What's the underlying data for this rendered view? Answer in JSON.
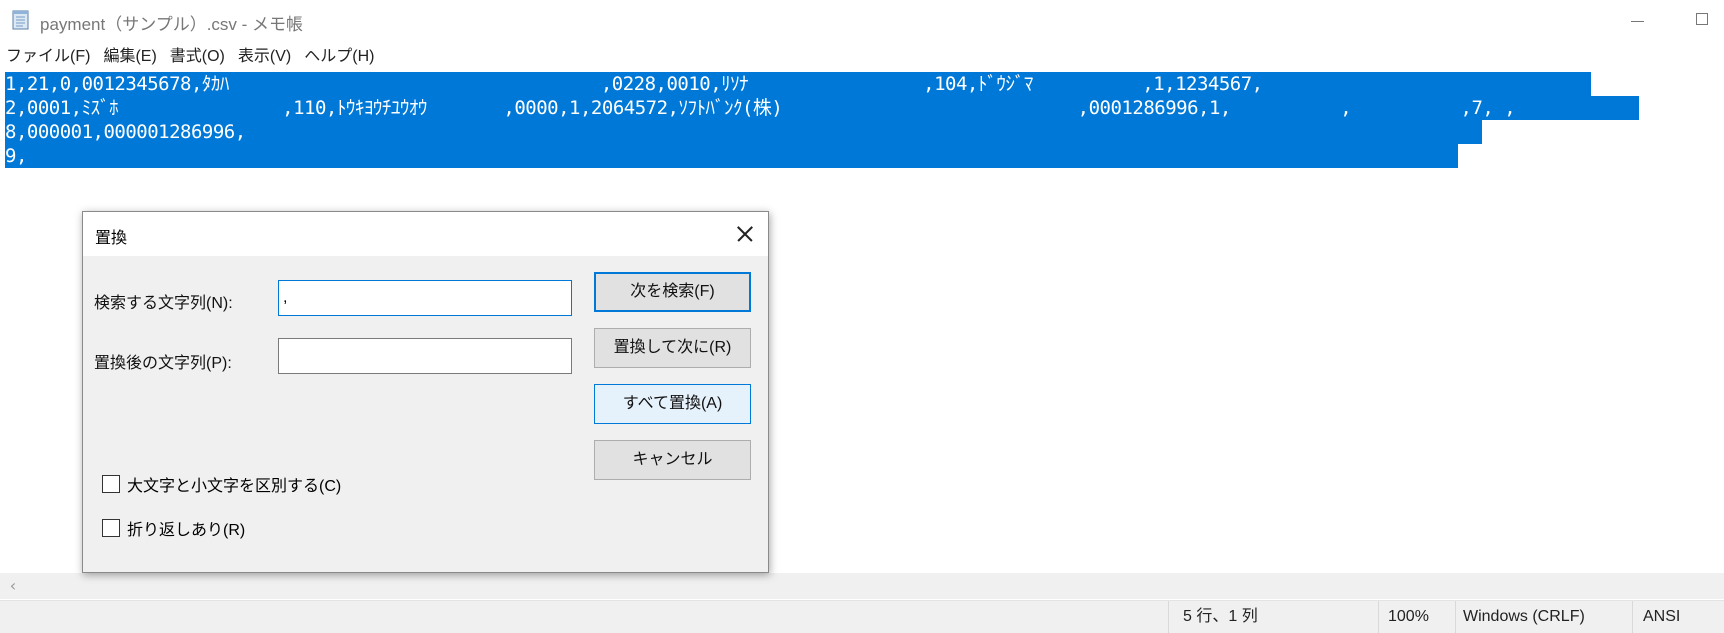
{
  "window": {
    "title": "payment（サンプル）.csv - メモ帳",
    "icon": "notepad-icon"
  },
  "menu": [
    "ファイル(F)",
    "編集(E)",
    "書式(O)",
    "表示(V)",
    "ヘルプ(H)"
  ],
  "editor": {
    "lines": [
      "1,21,0,0012345678,ﾀｶﾊ                                  ,0228,0010,ﾘｿﾅ                ,104,ﾄﾞｳｼﾞﾏ          ,1,1234567,",
      "2,0001,ﾐｽﾞﾎ               ,110,ﾄｳｷﾖｳﾁﾕｳｵｳ       ,0000,1,2064572,ｿﾌﾄﾊﾞﾝｸ(株)                           ,0001286996,1,          ,          ,7, ,",
      "8,000001,000001286996,",
      "9,"
    ],
    "selected": true
  },
  "status": {
    "position": "5 行、1 列",
    "zoom": "100%",
    "line_ending": "Windows (CRLF)",
    "encoding": "ANSI"
  },
  "replace_dialog": {
    "title": "置換",
    "find_label": "検索する文字列(N):",
    "find_value": ",",
    "replace_label": "置換後の文字列(P):",
    "replace_value": "",
    "buttons": {
      "find_next": "次を検索(F)",
      "replace_next": "置換して次に(R)",
      "replace_all": "すべて置換(A)",
      "cancel": "キャンセル"
    },
    "options": {
      "match_case": {
        "label": "大文字と小文字を区別する(C)",
        "checked": false
      },
      "wrap_around": {
        "label": "折り返しあり(R)",
        "checked": false
      }
    }
  },
  "colors": {
    "selection": "#0078d7",
    "accent": "#0078d7"
  }
}
